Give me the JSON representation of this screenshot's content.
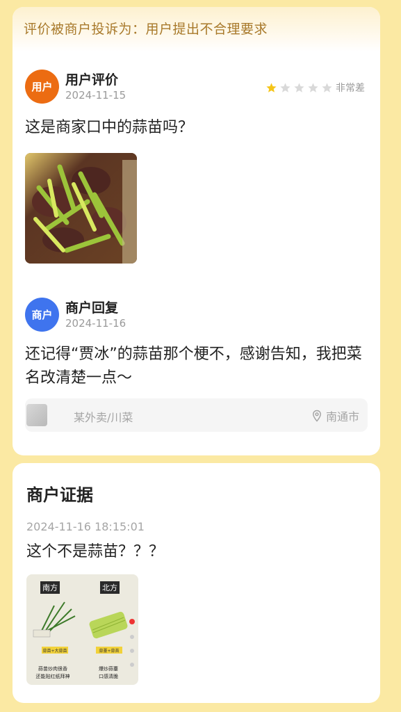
{
  "complaint": {
    "banner": "评价被商户投诉为：用户提出不合理要求"
  },
  "review": {
    "avatar_label": "用户",
    "author_label": "用户评价",
    "date": "2024-11-15",
    "rating": {
      "value": 1,
      "max": 5,
      "label": "非常差",
      "filled_color": "#f5c518",
      "empty_color": "#d9d9d9"
    },
    "text": "这是商家口中的蒜苗吗？",
    "photo_icon": "food-photo-icon"
  },
  "reply": {
    "avatar_label": "商户",
    "author_label": "商户回复",
    "date": "2024-11-16",
    "text": "还记得“贾冰”的蒜苗那个梗不，感谢告知，我把菜名改清楚一点～"
  },
  "shop": {
    "name": "某外卖/川菜",
    "location": "南通市",
    "location_icon": "location-pin-icon"
  },
  "evidence": {
    "title": "商户证据",
    "time": "2024-11-16 18:15:01",
    "text": "这个不是蒜苗？？？",
    "photo": {
      "left_label": "南方",
      "right_label": "北方",
      "left_tag": "蒜苗+大蒜苗",
      "right_tag": "蒜薹+蒜苔",
      "left_caption_1": "蒜苗炒肉很香",
      "left_caption_2": "还能贴红纸拜神",
      "right_caption_1": "爆炒蒜薹",
      "right_caption_2": "口感清脆"
    }
  },
  "colors": {
    "page_bg": "#fbe9a3",
    "banner_text": "#a8792a",
    "user_avatar": "#ec6c12",
    "merchant_avatar": "#3f74ee"
  }
}
